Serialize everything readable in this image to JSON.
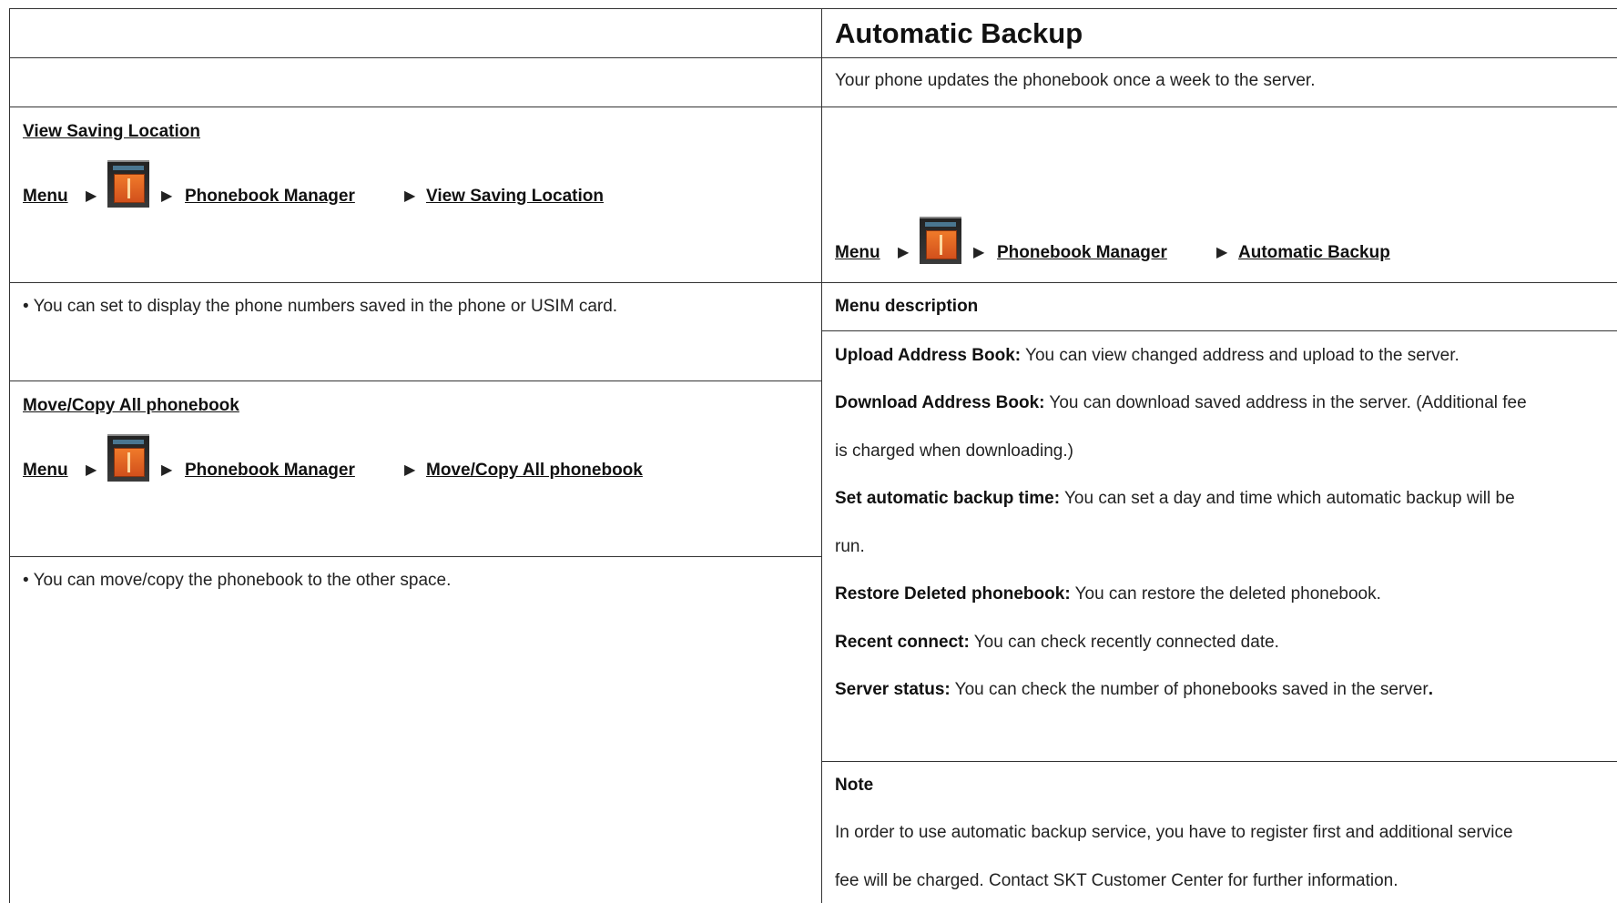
{
  "left": {
    "view_saving": {
      "title": "View Saving Location",
      "nav_menu": "Menu",
      "nav_manager": "Phonebook Manager",
      "nav_target": "View Saving Location",
      "desc": "• You can set to display the phone numbers saved in the phone or USIM card."
    },
    "move_copy": {
      "title": "Move/Copy All phonebook ",
      "nav_menu": "Menu",
      "nav_manager": "Phonebook Manager",
      "nav_target": "Move/Copy All phonebook",
      "desc": "• You can move/copy the phonebook to the other space."
    }
  },
  "right": {
    "heading": "Automatic Backup",
    "intro": "Your phone updates the phonebook once a week to the server.",
    "nav_menu": "Menu",
    "nav_manager": "Phonebook Manager",
    "nav_target": "Automatic Backup",
    "menu_desc_title": "Menu description",
    "items": [
      {
        "term": "Upload Address Book:",
        "text": " You can view changed address and upload to the server."
      },
      {
        "term": "Download Address Book:",
        "text": " You can download saved address in the server. (Additional fee"
      },
      {
        "term": "",
        "text": "is charged when downloading.)"
      },
      {
        "term": "Set automatic backup time:",
        "text": " You can set a day and time which automatic backup will be"
      },
      {
        "term": "",
        "text": "run."
      },
      {
        "term": "Restore Deleted phonebook:",
        "text": " You can restore the deleted phonebook."
      },
      {
        "term": "Recent connect:",
        "text": " You can check recently connected date."
      },
      {
        "term": "Server status:",
        "text": " You can check the number of phonebooks saved in the server",
        "suffix": "."
      }
    ],
    "note_title": "Note",
    "note_lines": [
      "In order to use automatic backup service, you have to register first and additional service",
      "fee will be charged. Contact SKT Customer Center for further information."
    ]
  },
  "icons": {
    "nav_arrow": "▶",
    "menu_app_icon": "phonebook-app-icon"
  }
}
